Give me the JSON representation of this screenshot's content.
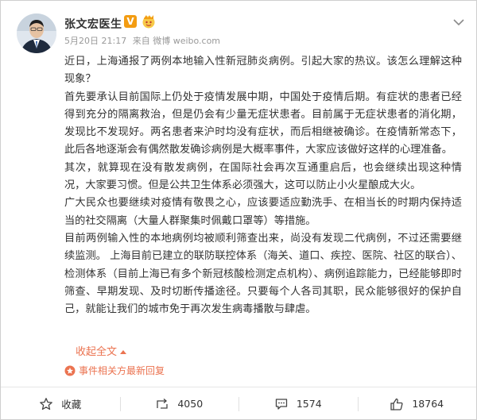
{
  "user": {
    "name": "张文宏医生",
    "vip_badge": "V"
  },
  "meta": {
    "time": "5月20日 21:17",
    "source": "来自 微博 weibo.com"
  },
  "post": {
    "paragraphs": [
      "近日，上海通报了两例本地输入性新冠肺炎病例。引起大家的热议。该怎么理解这种现象？",
      "首先要承认目前国际上仍处于疫情发展中期，中国处于疫情后期。有症状的患者已经得到充分的隔离救治，但是仍会有少量无症状患者。目前属于无症状患者的消化期，发现比不发现好。两名患者来沪时均没有症状，而后相继被确诊。在疫情新常态下，此后各地逐渐会有偶然散发确诊病例是大概率事件，大家应该做好这样的心理准备。",
      "其次，就算现在没有散发病例，在国际社会再次互通重启后，也会继续出现这种情况，大家要习惯。但是公共卫生体系必须强大，这可以防止小火星酿成大火。",
      "广大民众也要继续对疫情有敬畏之心，应该要适应勤洗手、在相当长的时期内保持适当的社交隔离（大量人群聚集时佩戴口罩等）等措施。",
      "目前两例输入性的本地病例均被顺利筛查出来，尚没有发现二代病例，不过还需要继续监测。 上海目前已建立的联防联控体系（海关、道口、疾控、医院、社区的联合）、检测体系（目前上海已有多个新冠核酸检测定点机构）、病例追踪能力，已经能够即时筛查、早期发现、及时切断传播途径。只要每个人各司其职，民众能够很好的保护自己，就能让我们的城市免于再次发生病毒播散与肆虐。"
    ],
    "collapse_label": "收起全文",
    "related_label": "事件相关方最新回复"
  },
  "actions": {
    "favorite_label": "收藏",
    "repost_count": "4050",
    "comment_count": "1574",
    "like_count": "18764"
  },
  "colors": {
    "accent": "#eb7350",
    "vip": "#f39c12",
    "meta_text": "#999999"
  },
  "icons": [
    "avatar",
    "vip-badge-icon",
    "fan-badge-icon",
    "chevron-down-icon",
    "related-event-icon",
    "star-icon",
    "repost-icon",
    "comment-icon",
    "thumbs-up-icon"
  ]
}
